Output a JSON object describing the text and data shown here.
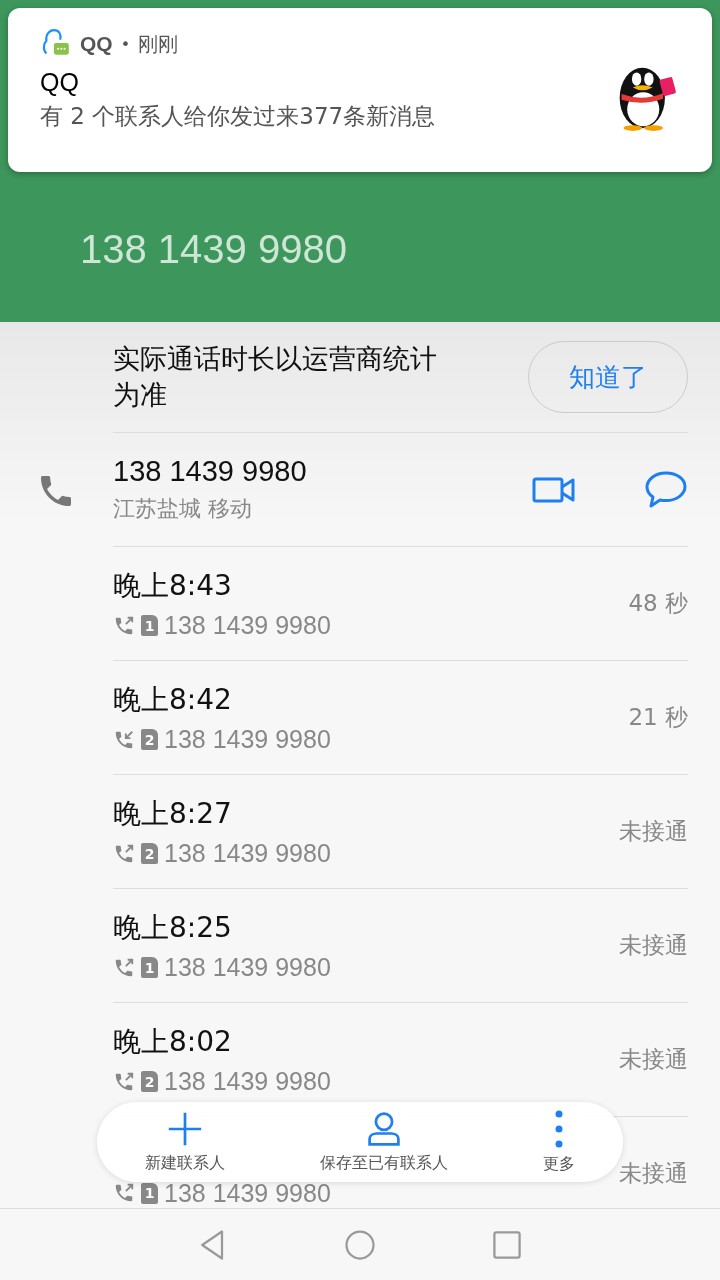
{
  "notification": {
    "app": "QQ",
    "separator": "•",
    "time": "刚刚",
    "title": "QQ",
    "message": "有 2 个联系人给你发过来377条新消息"
  },
  "header": {
    "number": "138 1439 9980"
  },
  "notice": {
    "text": "实际通话时长以运营商统计为准",
    "button": "知道了"
  },
  "contact": {
    "number": "138 1439 9980",
    "location": "江苏盐城 移动"
  },
  "calls": [
    {
      "time": "晚上8:43",
      "kind": "outgoing",
      "sim": "1",
      "number": "138 1439 9980",
      "result": "48 秒"
    },
    {
      "time": "晚上8:42",
      "kind": "incoming",
      "sim": "2",
      "number": "138 1439 9980",
      "result": "21 秒"
    },
    {
      "time": "晚上8:27",
      "kind": "outgoing",
      "sim": "2",
      "number": "138 1439 9980",
      "result": "未接通"
    },
    {
      "time": "晚上8:25",
      "kind": "outgoing",
      "sim": "1",
      "number": "138 1439 9980",
      "result": "未接通"
    },
    {
      "time": "晚上8:02",
      "kind": "outgoing",
      "sim": "2",
      "number": "138 1439 9980",
      "result": "未接通"
    },
    {
      "kind": "outgoing",
      "sim": "1",
      "number": "138 1439 9980",
      "result": "未接通"
    }
  ],
  "actions": [
    {
      "kind": "add",
      "label": "新建联系人"
    },
    {
      "kind": "person",
      "label": "保存至已有联系人"
    },
    {
      "kind": "more",
      "label": "更多"
    }
  ]
}
